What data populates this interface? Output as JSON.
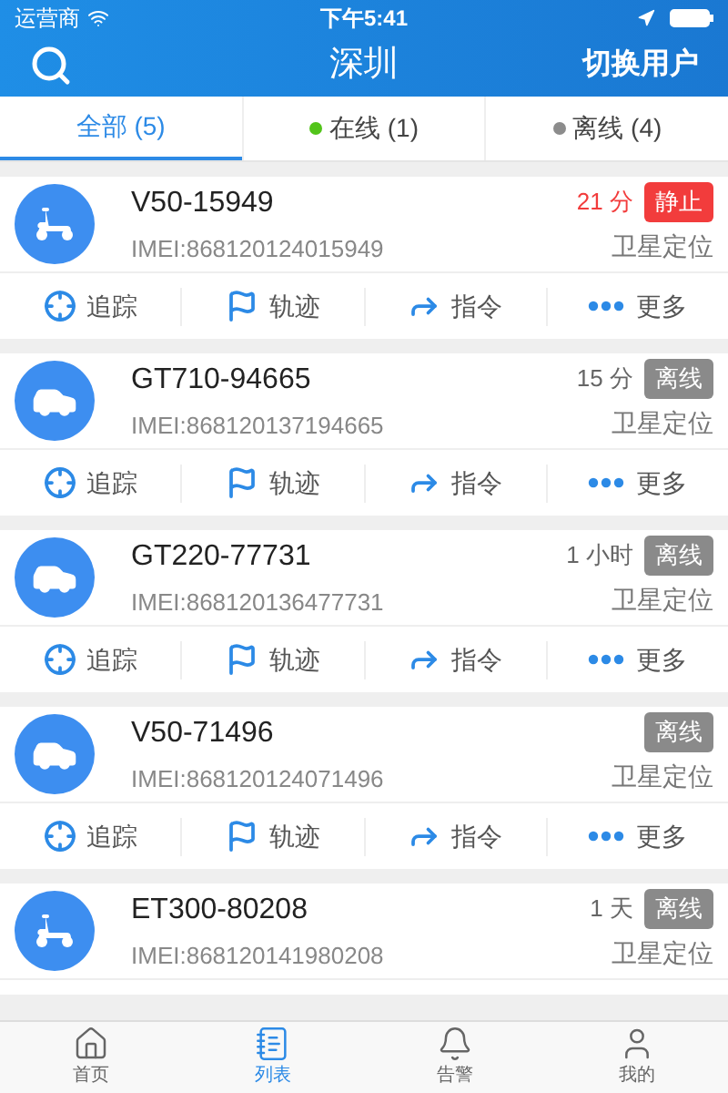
{
  "status_bar": {
    "carrier": "运营商",
    "time": "下午5:41"
  },
  "header": {
    "title": "深圳",
    "switch_user": "切换用户"
  },
  "filters": [
    {
      "label": "全部 (5)",
      "selected": true
    },
    {
      "label": "在线 (1)",
      "selected": false,
      "color": "#52c41a"
    },
    {
      "label": "离线 (4)",
      "selected": false,
      "color": "#8c8c8c"
    }
  ],
  "vehicles": [
    {
      "kind": "scooter",
      "name": "V50-15949",
      "imei": "IMEI:868120124015949",
      "time": "21 分",
      "time_alert": true,
      "status": "静止",
      "color": "#f23c3c",
      "location": "卫星定位",
      "actions": [
        "追踪",
        "轨迹",
        "指令",
        "更多"
      ]
    },
    {
      "kind": "car",
      "name": "GT710-94665",
      "imei": "IMEI:868120137194665",
      "time": "15 分",
      "time_alert": false,
      "status": "离线",
      "color": "#8a8a8a",
      "location": "卫星定位",
      "actions": [
        "追踪",
        "轨迹",
        "指令",
        "更多"
      ]
    },
    {
      "kind": "car",
      "name": "GT220-77731",
      "imei": "IMEI:868120136477731",
      "time": "1 小时",
      "time_alert": false,
      "status": "离线",
      "color": "#8a8a8a",
      "location": "卫星定位",
      "actions": [
        "追踪",
        "轨迹",
        "指令",
        "更多"
      ]
    },
    {
      "kind": "car",
      "name": "V50-71496",
      "imei": "IMEI:868120124071496",
      "status": "离线",
      "color": "#8a8a8a",
      "location": "卫星定位",
      "actions": [
        "追踪",
        "轨迹",
        "指令",
        "更多"
      ]
    },
    {
      "kind": "scooter",
      "name": "ET300-80208",
      "imei": "IMEI:868120141980208",
      "time": "1 天",
      "time_alert": false,
      "status": "离线",
      "color": "#8a8a8a",
      "location": "卫星定位"
    }
  ],
  "tab_bar": [
    {
      "label": "首页",
      "selected": false
    },
    {
      "label": "列表",
      "selected": true
    },
    {
      "label": "告警",
      "selected": false
    },
    {
      "label": "我的",
      "selected": false
    }
  ]
}
